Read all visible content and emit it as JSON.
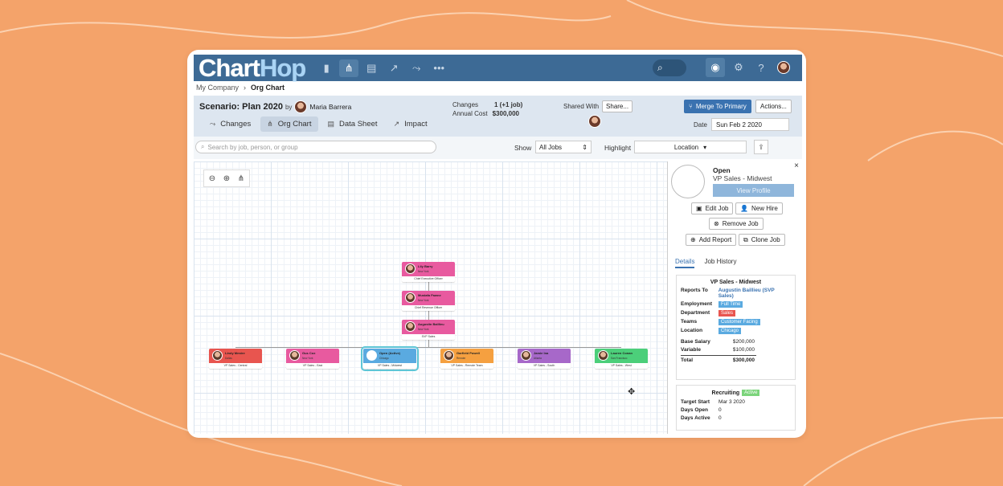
{
  "app": {
    "logo_chart": "Chart",
    "logo_hop": "Hop"
  },
  "breadcrumb": {
    "root": "My Company",
    "current": "Org Chart"
  },
  "scenario": {
    "label": "Scenario: Plan 2020",
    "by": "by",
    "owner": "Maria Barrera",
    "tabs": [
      {
        "label": "Changes"
      },
      {
        "label": "Org Chart"
      },
      {
        "label": "Data Sheet"
      },
      {
        "label": "Impact"
      }
    ],
    "changes_label": "Changes",
    "changes_value": "1 (+1 job)",
    "annual_cost_label": "Annual Cost",
    "annual_cost_value": "$300,000",
    "shared_with_label": "Shared With",
    "share_button": "Share...",
    "merge_button": "Merge To Primary",
    "actions_button": "Actions...",
    "date_label": "Date",
    "date_value": "Sun Feb 2 2020"
  },
  "filters": {
    "search_placeholder": "Search by job, person, or group",
    "show_label": "Show",
    "show_value": "All Jobs",
    "highlight_label": "Highlight",
    "highlight_value": "Location"
  },
  "org_chart": {
    "chain": [
      {
        "name": "Lily Barry",
        "location": "New York",
        "title": "Chief Executive Officer",
        "color": "#e85a9f"
      },
      {
        "name": "Mustafa Fawne",
        "location": "New York",
        "title": "Chief Revenue Officer",
        "color": "#e85a9f"
      },
      {
        "name": "Augustin Baillieu",
        "location": "New York",
        "title": "SVP Sales",
        "color": "#e85a9f"
      }
    ],
    "reports": [
      {
        "name": "Lindy Mestre",
        "location": "Dallas",
        "title": "VP Sales - Central",
        "color": "#e8554f"
      },
      {
        "name": "Gus Cox",
        "location": "New York",
        "title": "VP Sales - East",
        "color": "#e85a9f"
      },
      {
        "name": "Open (Active)",
        "location": "Chicago",
        "title": "VP Sales - Midwest",
        "color": "#5aaae0"
      },
      {
        "name": "Garfield Powell",
        "location": "Remote",
        "title": "VP Sales - Remote Team",
        "color": "#f5a040"
      },
      {
        "name": "Jamie Ina",
        "location": "Atlanta",
        "title": "VP Sales - South",
        "color": "#a768c9"
      },
      {
        "name": "Lauren Conan",
        "location": "San Francisco",
        "title": "VP Sales - West",
        "color": "#4ccf7a"
      }
    ]
  },
  "panel": {
    "status": "Open",
    "role": "VP Sales - Midwest",
    "view_profile": "View Profile",
    "edit_job": "Edit Job",
    "new_hire": "New Hire",
    "remove_job": "Remove Job",
    "add_report": "Add Report",
    "clone_job": "Clone Job",
    "tab_details": "Details",
    "tab_job_history": "Job History",
    "details": {
      "title": "VP Sales - Midwest",
      "reports_to_label": "Reports To",
      "reports_to_value": "Augustin Baillieu (SVP Sales)",
      "employment_label": "Employment",
      "employment_value": "Full Time",
      "department_label": "Department",
      "department_value": "Sales",
      "teams_label": "Teams",
      "teams_value": "Customer Facing",
      "location_label": "Location",
      "location_value": "Chicago",
      "base_salary_label": "Base Salary",
      "base_salary_value": "$200,000",
      "variable_label": "Variable",
      "variable_value": "$100,000",
      "total_label": "Total",
      "total_value": "$300,000"
    },
    "recruiting": {
      "title": "Recruiting",
      "status": "Active",
      "target_start_label": "Target Start",
      "target_start_value": "Mar 3 2020",
      "days_open_label": "Days Open",
      "days_open_value": "0",
      "days_active_label": "Days Active",
      "days_active_value": "0"
    }
  },
  "colors": {
    "background": "#f4a36a",
    "topbar": "#3d6a95",
    "accent": "#3a72b0",
    "tag_full_time": "#5aaae0",
    "tag_sales": "#e8554f",
    "tag_customer_facing": "#5aaae0",
    "tag_chicago": "#5aaae0"
  }
}
